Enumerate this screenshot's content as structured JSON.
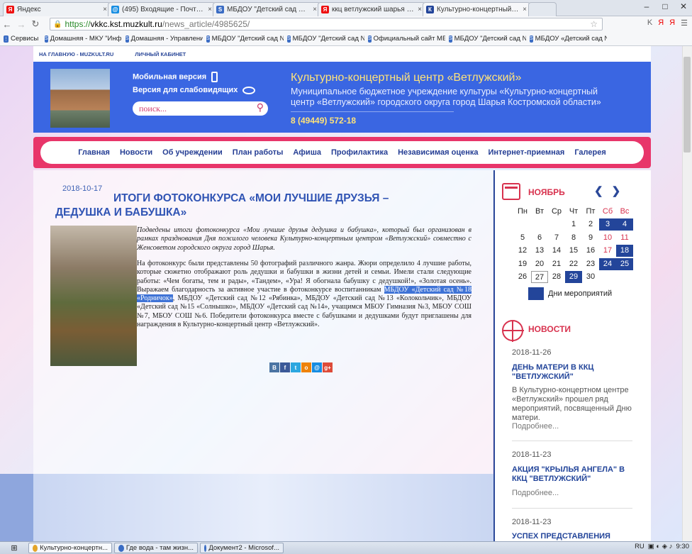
{
  "browser": {
    "tabs": [
      {
        "icon": "yandex-icon",
        "title": "Яндекс"
      },
      {
        "icon": "mail-icon",
        "title": "(495) Входящие - Почта М"
      },
      {
        "icon": "school-icon",
        "title": "МБДОУ \"Детский сад №18"
      },
      {
        "icon": "yandex-icon",
        "title": "ккц ветлужский шарья офи"
      },
      {
        "icon": "site-icon",
        "title": "Культурно-концертный це"
      }
    ],
    "url_scheme": "https://",
    "url_host": "vkkc.kst.muzkult.ru",
    "url_path": "/news_article/4985625/",
    "bookmarks": [
      "Сервисы",
      "Домашняя - МКУ \"Инф",
      "Домашняя - Управлени",
      "МБДОУ \"Детский сад №",
      "МБДОУ \"Детский сад №",
      "Официальный сайт МБ",
      "МБДОУ \"Детский сад №",
      "МБДОУ «Детский сад №"
    ]
  },
  "site": {
    "top_links": [
      "НА ГЛАВНУЮ - MUZKULT.RU",
      "ЛИЧНЫЙ КАБИНЕТ"
    ],
    "mobile_version": "Мобильная версия",
    "low_vision_version": "Версия для слабовидящих",
    "search_placeholder": "поиск...",
    "org_title": "Культурно-концертный центр «Ветлужский»",
    "org_description": "Муниципальное бюджетное учреждение культуры «Культурно-концертный центр «Ветлужский» городского округа город Шарья Костромской области»",
    "phone": "8 (49449) 572-18",
    "nav": [
      "Главная",
      "Новости",
      "Об учреждении",
      "План работы",
      "Афиша",
      "Профилактика",
      "Независимая оценка",
      "Интернет-приемная",
      "Галерея"
    ]
  },
  "article": {
    "date": "2018-10-17",
    "title": "ИТОГИ ФОТОКОНКУРСА «МОИ ЛУЧШИЕ ДРУЗЬЯ – ДЕДУШКА И БАБУШКА»",
    "intro": "Подведены итоги фотоконкурса «Мои лучшие друзья дедушка и бабушка», который был организован в рамках празднования Дня пожилого человека Культурно-концертным центром «Ветлужский» совместно с Женсоветом городского округа город Шарья.",
    "body_before": "На фотоконкурс были представлены 50 фотографий различного жанра. Жюри определило 4 лучшие работы, которые сюжетно отображают роль дедушки и бабушки в жизни детей и семьи. Имели стали следующие работы: «Чем богаты, тем и рады», «Тандем», «Ура! Я обогнала бабушку с дедушкой!», «Золотая осень». Выражаем благодарность за активное участие в фотоконкурсе воспитанникам ",
    "body_highlight": "МБДОУ «Детский сад №18 «Родничок»",
    "body_after": ", МБДОУ «Детский сад №12 «Рябинка», МБДОУ «Детский сад №13 «Колокольчик», МБДОУ «Детский сад №15 «Солнышко», МБДОУ «Детский сад №14», учащимся МБОУ Гимназия №3, МБОУ СОШ №7, МБОУ СОШ №6. Победители фотоконкурса вместе с бабушками и дедушками будут приглашены для награждения в Культурно-концертный центр «Ветлужский».",
    "share": [
      {
        "label": "В",
        "color": "#4c75a3"
      },
      {
        "label": "f",
        "color": "#3b5998"
      },
      {
        "label": "t",
        "color": "#2ca7e0"
      },
      {
        "label": "о",
        "color": "#ee8208"
      },
      {
        "label": "@",
        "color": "#168de2"
      },
      {
        "label": "g+",
        "color": "#dd4b39"
      }
    ]
  },
  "calendar": {
    "month": "НОЯБРЬ",
    "weekdays": [
      "Пн",
      "Вт",
      "Ср",
      "Чт",
      "Пт",
      "Сб",
      "Вс"
    ],
    "weeks": [
      [
        "",
        "",
        "",
        "1",
        "2",
        "3",
        "4"
      ],
      [
        "5",
        "6",
        "7",
        "8",
        "9",
        "10",
        "11"
      ],
      [
        "12",
        "13",
        "14",
        "15",
        "16",
        "17",
        "18"
      ],
      [
        "19",
        "20",
        "21",
        "22",
        "23",
        "24",
        "25"
      ],
      [
        "26",
        "27",
        "28",
        "29",
        "30",
        "",
        ""
      ]
    ],
    "event_days": [
      "3",
      "4",
      "18",
      "24",
      "25",
      "29"
    ],
    "today": "27",
    "legend": "Дни мероприятий"
  },
  "news": {
    "label": "НОВОСТИ",
    "items": [
      {
        "date": "2018-11-26",
        "title": "ДЕНЬ МАТЕРИ В ККЦ \"ВЕТЛУЖСКИЙ\"",
        "text": "В Культурно-концертном центре «Ветлужский» прошел ряд мероприятий, посвященный Дню матери.",
        "more": "Подробнее..."
      },
      {
        "date": "2018-11-23",
        "title": "АКЦИЯ \"КРЫЛЬЯ АНГЕЛА\" В ККЦ \"ВЕТЛУЖСКИЙ\"",
        "text": "",
        "more": "Подробнее..."
      },
      {
        "date": "2018-11-23",
        "title": "УСПЕХ ПРЕДСТАВЛЕНИЯ",
        "text": "",
        "more": ""
      }
    ]
  },
  "taskbar": {
    "items": [
      "Культурно-концертн...",
      "Где вода - там жизн...",
      "Документ2 - Microsof..."
    ],
    "lang": "RU",
    "time": "9:30"
  }
}
